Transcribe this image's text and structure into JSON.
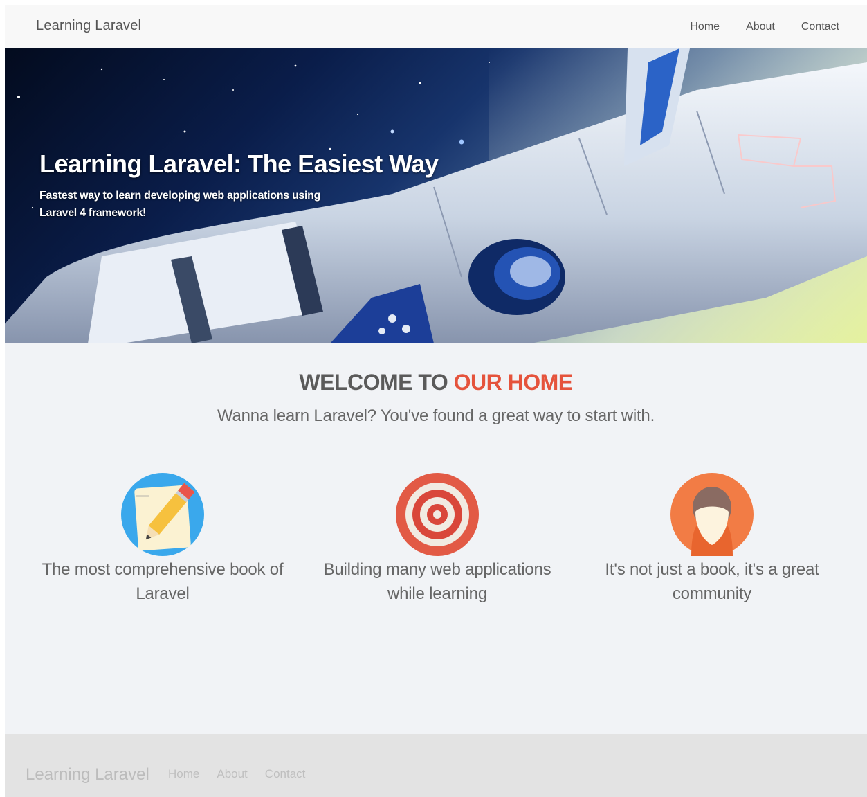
{
  "navbar": {
    "brand": "Learning Laravel",
    "items": [
      {
        "label": "Home"
      },
      {
        "label": "About"
      },
      {
        "label": "Contact"
      }
    ]
  },
  "hero": {
    "title": "Learning Laravel: The Easiest Way",
    "subtitle": "Fastest way to learn developing web applications using Laravel 4 framework!"
  },
  "welcome": {
    "title_part1": "WELCOME TO",
    "title_part2": "OUR HOME",
    "lead": "Wanna learn Laravel? You've found a great way to start with."
  },
  "features": [
    {
      "icon": "pencil-note-icon",
      "caption": "The most comprehensive book of Laravel"
    },
    {
      "icon": "target-icon",
      "caption": "Building many web applications while learning"
    },
    {
      "icon": "user-avatar-icon",
      "caption": "It's not just a book, it's a great community"
    }
  ],
  "footer": {
    "brand": "Learning Laravel",
    "items": [
      {
        "label": "Home"
      },
      {
        "label": "About"
      },
      {
        "label": "Contact"
      }
    ]
  },
  "colors": {
    "accent": "#e5533c",
    "navbar_bg": "#f8f8f8",
    "page_bg": "#f1f3f6",
    "footer_bg": "#e3e3e3"
  }
}
